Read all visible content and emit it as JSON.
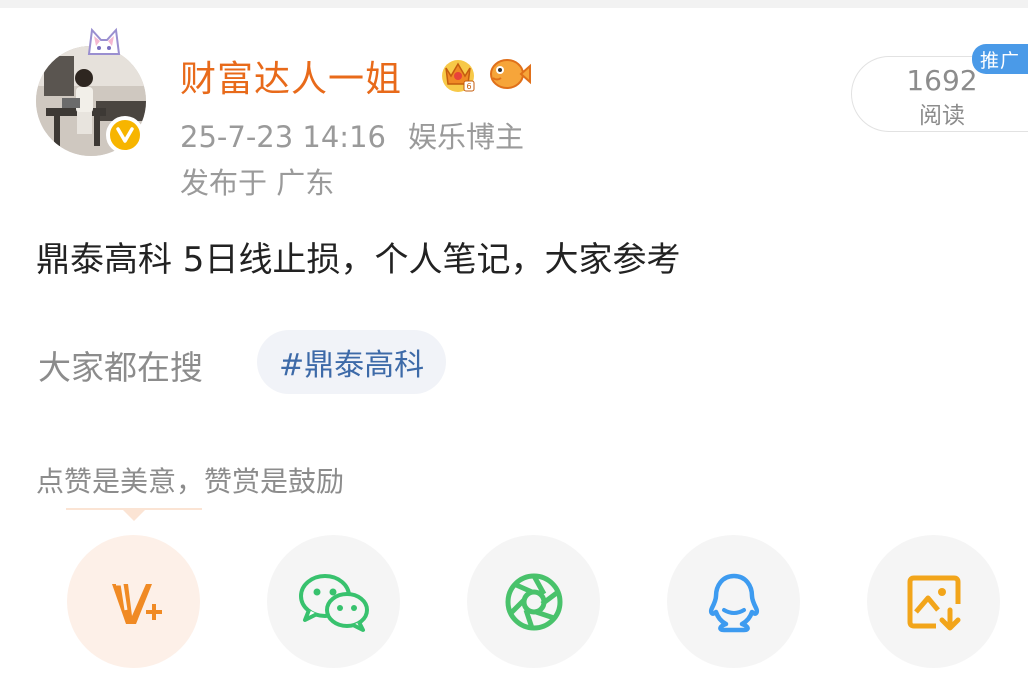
{
  "user": {
    "name": "财富达人一姐",
    "timestamp": "25-7-23 14:16",
    "role": "娱乐博主",
    "location": "发布于 广东"
  },
  "stats": {
    "read_count": "1692",
    "read_label": "阅读",
    "promo_badge": "推广"
  },
  "post": {
    "text": "鼎泰高科  5日线止损，个人笔记，大家参考"
  },
  "search": {
    "label": "大家都在搜",
    "hashtag": "#鼎泰高科"
  },
  "reward": {
    "text": "点赞是美意，赞赏是鼓励"
  },
  "share_options": [
    {
      "icon": "weibo-reward-icon",
      "color": "#f08a24"
    },
    {
      "icon": "wechat-icon",
      "color": "#38c26e"
    },
    {
      "icon": "moments-icon",
      "color": "#49c26b"
    },
    {
      "icon": "qq-icon",
      "color": "#3d9bf0"
    },
    {
      "icon": "save-image-icon",
      "color": "#f2a51a"
    }
  ],
  "colors": {
    "username": "#e86a1a",
    "hashtag": "#3d6aa8",
    "promo": "#4a9ae8",
    "verified": "#f7b500"
  }
}
